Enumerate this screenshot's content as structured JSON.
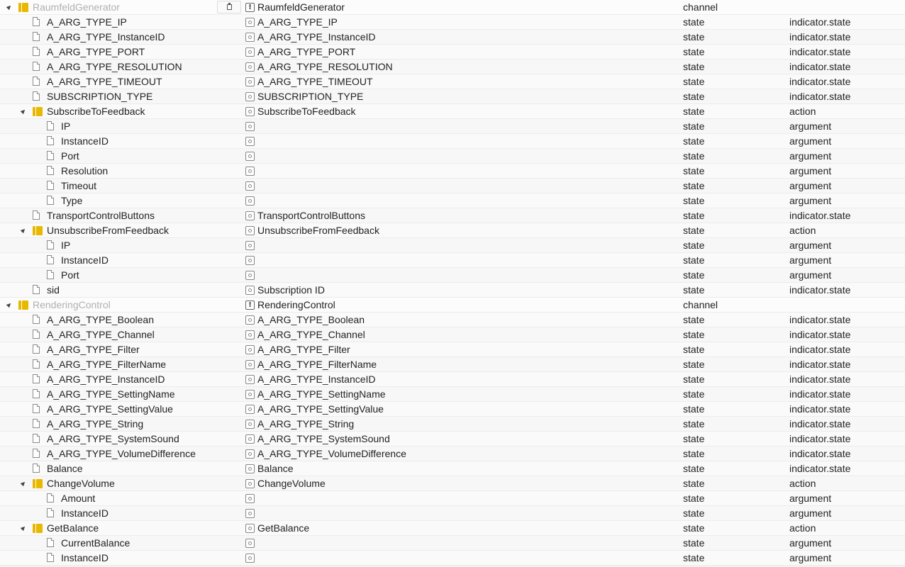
{
  "rows": [
    {
      "name": "RaumfeldGenerator",
      "title": "RaumfeldGenerator",
      "type": "channel",
      "role": "",
      "level": 0,
      "kind": "channel"
    },
    {
      "name": "A_ARG_TYPE_IP",
      "title": "A_ARG_TYPE_IP",
      "type": "state",
      "role": "indicator.state",
      "level": 1,
      "kind": "state"
    },
    {
      "name": "A_ARG_TYPE_InstanceID",
      "title": "A_ARG_TYPE_InstanceID",
      "type": "state",
      "role": "indicator.state",
      "level": 1,
      "kind": "state"
    },
    {
      "name": "A_ARG_TYPE_PORT",
      "title": "A_ARG_TYPE_PORT",
      "type": "state",
      "role": "indicator.state",
      "level": 1,
      "kind": "state"
    },
    {
      "name": "A_ARG_TYPE_RESOLUTION",
      "title": "A_ARG_TYPE_RESOLUTION",
      "type": "state",
      "role": "indicator.state",
      "level": 1,
      "kind": "state"
    },
    {
      "name": "A_ARG_TYPE_TIMEOUT",
      "title": "A_ARG_TYPE_TIMEOUT",
      "type": "state",
      "role": "indicator.state",
      "level": 1,
      "kind": "state"
    },
    {
      "name": "SUBSCRIPTION_TYPE",
      "title": "SUBSCRIPTION_TYPE",
      "type": "state",
      "role": "indicator.state",
      "level": 1,
      "kind": "state"
    },
    {
      "name": "SubscribeToFeedback",
      "title": "SubscribeToFeedback",
      "type": "state",
      "role": "action",
      "level": 1,
      "kind": "folder"
    },
    {
      "name": "IP",
      "title": "",
      "type": "state",
      "role": "argument",
      "level": 2,
      "kind": "state"
    },
    {
      "name": "InstanceID",
      "title": "",
      "type": "state",
      "role": "argument",
      "level": 2,
      "kind": "state"
    },
    {
      "name": "Port",
      "title": "",
      "type": "state",
      "role": "argument",
      "level": 2,
      "kind": "state"
    },
    {
      "name": "Resolution",
      "title": "",
      "type": "state",
      "role": "argument",
      "level": 2,
      "kind": "state"
    },
    {
      "name": "Timeout",
      "title": "",
      "type": "state",
      "role": "argument",
      "level": 2,
      "kind": "state"
    },
    {
      "name": "Type",
      "title": "",
      "type": "state",
      "role": "argument",
      "level": 2,
      "kind": "state"
    },
    {
      "name": "TransportControlButtons",
      "title": "TransportControlButtons",
      "type": "state",
      "role": "indicator.state",
      "level": 1,
      "kind": "state"
    },
    {
      "name": "UnsubscribeFromFeedback",
      "title": "UnsubscribeFromFeedback",
      "type": "state",
      "role": "action",
      "level": 1,
      "kind": "folder"
    },
    {
      "name": "IP",
      "title": "",
      "type": "state",
      "role": "argument",
      "level": 2,
      "kind": "state"
    },
    {
      "name": "InstanceID",
      "title": "",
      "type": "state",
      "role": "argument",
      "level": 2,
      "kind": "state"
    },
    {
      "name": "Port",
      "title": "",
      "type": "state",
      "role": "argument",
      "level": 2,
      "kind": "state"
    },
    {
      "name": "sid",
      "title": "Subscription ID",
      "type": "state",
      "role": "indicator.state",
      "level": 1,
      "kind": "state"
    },
    {
      "name": "RenderingControl",
      "title": "RenderingControl",
      "type": "channel",
      "role": "",
      "level": 0,
      "kind": "channel"
    },
    {
      "name": "A_ARG_TYPE_Boolean",
      "title": "A_ARG_TYPE_Boolean",
      "type": "state",
      "role": "indicator.state",
      "level": 1,
      "kind": "state"
    },
    {
      "name": "A_ARG_TYPE_Channel",
      "title": "A_ARG_TYPE_Channel",
      "type": "state",
      "role": "indicator.state",
      "level": 1,
      "kind": "state"
    },
    {
      "name": "A_ARG_TYPE_Filter",
      "title": "A_ARG_TYPE_Filter",
      "type": "state",
      "role": "indicator.state",
      "level": 1,
      "kind": "state"
    },
    {
      "name": "A_ARG_TYPE_FilterName",
      "title": "A_ARG_TYPE_FilterName",
      "type": "state",
      "role": "indicator.state",
      "level": 1,
      "kind": "state"
    },
    {
      "name": "A_ARG_TYPE_InstanceID",
      "title": "A_ARG_TYPE_InstanceID",
      "type": "state",
      "role": "indicator.state",
      "level": 1,
      "kind": "state"
    },
    {
      "name": "A_ARG_TYPE_SettingName",
      "title": "A_ARG_TYPE_SettingName",
      "type": "state",
      "role": "indicator.state",
      "level": 1,
      "kind": "state"
    },
    {
      "name": "A_ARG_TYPE_SettingValue",
      "title": "A_ARG_TYPE_SettingValue",
      "type": "state",
      "role": "indicator.state",
      "level": 1,
      "kind": "state"
    },
    {
      "name": "A_ARG_TYPE_String",
      "title": "A_ARG_TYPE_String",
      "type": "state",
      "role": "indicator.state",
      "level": 1,
      "kind": "state"
    },
    {
      "name": "A_ARG_TYPE_SystemSound",
      "title": "A_ARG_TYPE_SystemSound",
      "type": "state",
      "role": "indicator.state",
      "level": 1,
      "kind": "state"
    },
    {
      "name": "A_ARG_TYPE_VolumeDifference",
      "title": "A_ARG_TYPE_VolumeDifference",
      "type": "state",
      "role": "indicator.state",
      "level": 1,
      "kind": "state"
    },
    {
      "name": "Balance",
      "title": "Balance",
      "type": "state",
      "role": "indicator.state",
      "level": 1,
      "kind": "state"
    },
    {
      "name": "ChangeVolume",
      "title": "ChangeVolume",
      "type": "state",
      "role": "action",
      "level": 1,
      "kind": "folder"
    },
    {
      "name": "Amount",
      "title": "",
      "type": "state",
      "role": "argument",
      "level": 2,
      "kind": "state"
    },
    {
      "name": "InstanceID",
      "title": "",
      "type": "state",
      "role": "argument",
      "level": 2,
      "kind": "state"
    },
    {
      "name": "GetBalance",
      "title": "GetBalance",
      "type": "state",
      "role": "action",
      "level": 1,
      "kind": "folder"
    },
    {
      "name": "CurrentBalance",
      "title": "",
      "type": "state",
      "role": "argument",
      "level": 2,
      "kind": "state"
    },
    {
      "name": "InstanceID",
      "title": "",
      "type": "state",
      "role": "argument",
      "level": 2,
      "kind": "state"
    }
  ],
  "icons": {
    "folder": "folder-icon",
    "file": "file-icon",
    "state": "state-circle-icon",
    "channel": "info-icon",
    "toggle": "expand-toggle-icon",
    "copy": "clipboard-icon"
  },
  "colors": {
    "folder": "#e8b800",
    "muted_channel_text": "#b0b0b0"
  }
}
